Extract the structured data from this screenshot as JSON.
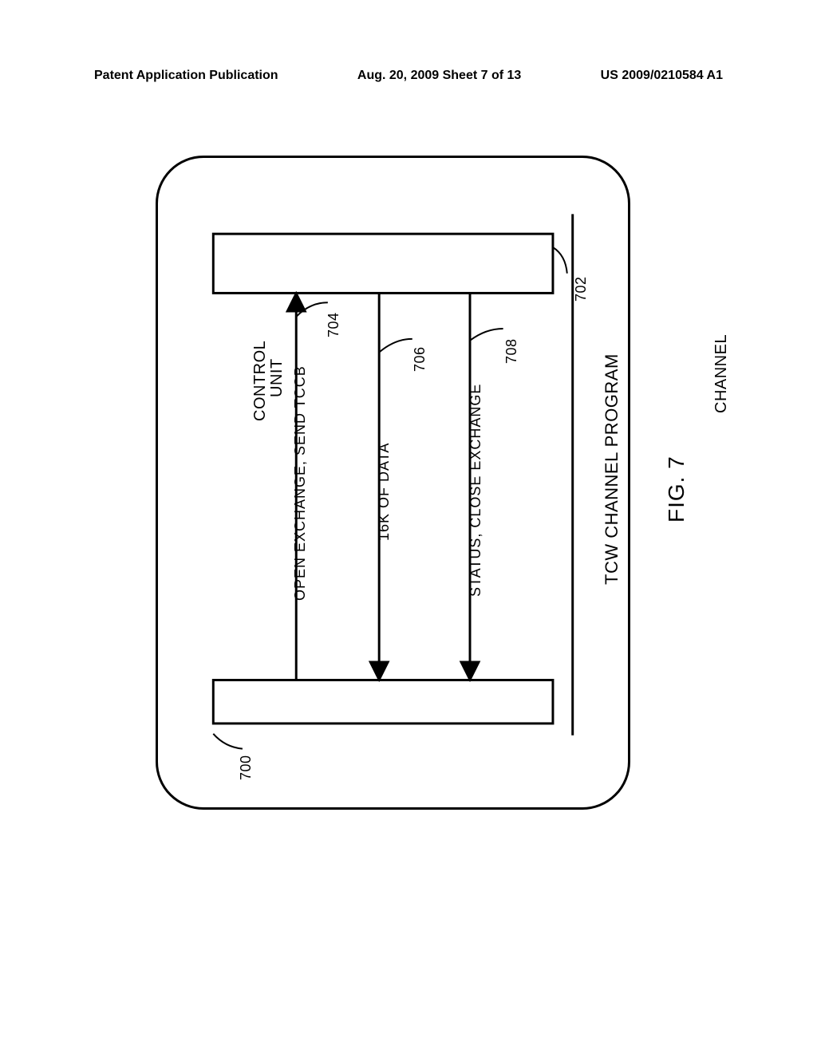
{
  "header": {
    "left": "Patent Application Publication",
    "center": "Aug. 20, 2009  Sheet 7 of 13",
    "right": "US 2009/0210584 A1"
  },
  "figure": {
    "title": "TCW CHANNEL PROGRAM",
    "caption": "FIG. 7",
    "blocks": {
      "channel": "CHANNEL",
      "control_unit": "CONTROL\nUNIT"
    },
    "refs": {
      "channel": "700",
      "control_unit": "702",
      "msg1": "704",
      "msg2": "706",
      "msg3": "708"
    },
    "messages": {
      "open": "OPEN EXCHANGE, SEND TCCB",
      "data": "16K OF DATA",
      "status": "STATUS, CLOSE EXCHANGE"
    }
  }
}
